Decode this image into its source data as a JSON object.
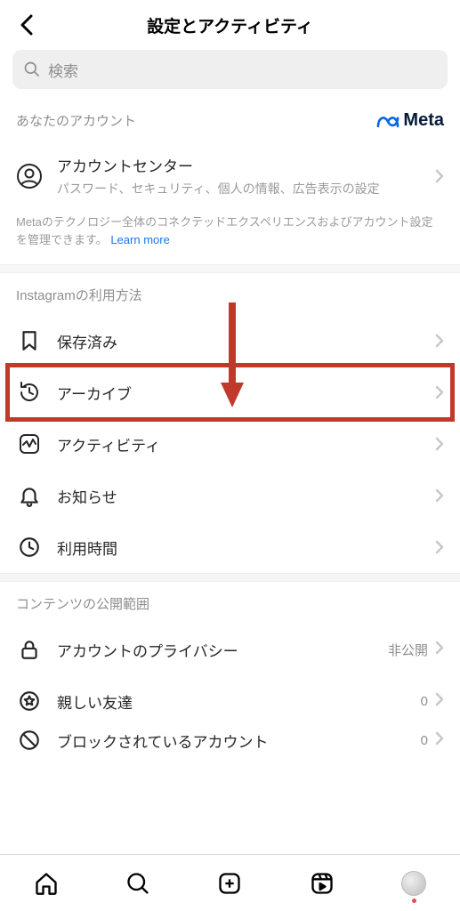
{
  "header": {
    "title": "設定とアクティビティ"
  },
  "search": {
    "placeholder": "検索"
  },
  "account_section": {
    "heading": "あなたのアカウント",
    "brand": "Meta",
    "item_title": "アカウントセンター",
    "item_sub": "パスワード、セキュリティ、個人の情報、広告表示の設定",
    "note_prefix": "Metaのテクノロジー全体のコネクテッドエクスペリエンスおよびアカウント設定を管理できます。",
    "note_link": "Learn more"
  },
  "usage_section": {
    "heading": "Instagramの利用方法",
    "items": [
      {
        "label": "保存済み"
      },
      {
        "label": "アーカイブ"
      },
      {
        "label": "アクティビティ"
      },
      {
        "label": "お知らせ"
      },
      {
        "label": "利用時間"
      }
    ]
  },
  "visibility_section": {
    "heading": "コンテンツの公開範囲",
    "items": [
      {
        "label": "アカウントのプライバシー",
        "trail": "非公開"
      },
      {
        "label": "親しい友達",
        "trail": "0"
      },
      {
        "label": "ブロックされているアカウント",
        "trail": "0"
      }
    ]
  }
}
